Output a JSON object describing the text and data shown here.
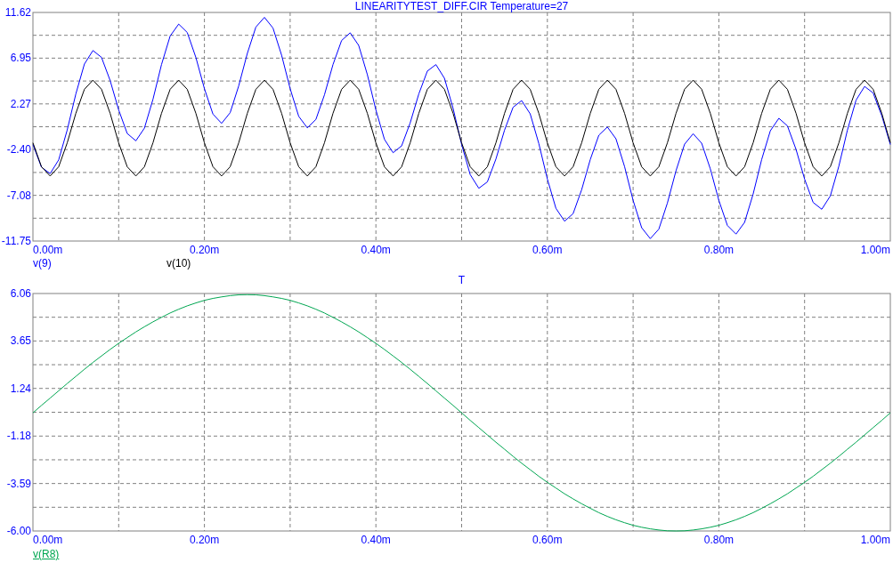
{
  "plots": [
    {
      "legend": [
        {
          "selected": false
        },
        {
          "selected": false
        }
      ],
      "chart_data": {
        "type": "line",
        "grid": true,
        "title": "LINEARITYTEST_DIFF.CIR Temperature=27",
        "x": [
          0,
          0.01,
          0.02,
          0.03,
          0.04,
          0.05,
          0.06,
          0.07,
          0.08,
          0.09,
          0.1,
          0.11,
          0.12,
          0.13,
          0.14,
          0.15,
          0.16,
          0.17,
          0.18,
          0.19,
          0.2,
          0.21,
          0.22,
          0.23,
          0.24,
          0.25,
          0.26,
          0.27,
          0.28,
          0.29,
          0.3,
          0.31,
          0.32,
          0.33,
          0.34,
          0.35,
          0.36,
          0.37,
          0.38,
          0.39,
          0.4,
          0.41,
          0.42,
          0.43,
          0.44,
          0.45,
          0.46,
          0.47,
          0.48,
          0.49,
          0.5,
          0.51,
          0.52,
          0.53,
          0.54,
          0.55,
          0.56,
          0.57,
          0.58,
          0.59,
          0.6,
          0.61,
          0.62,
          0.63,
          0.64,
          0.65,
          0.66,
          0.67,
          0.68,
          0.69,
          0.7,
          0.71,
          0.72,
          0.73,
          0.74,
          0.75,
          0.76,
          0.77,
          0.78,
          0.79,
          0.8,
          0.81,
          0.82,
          0.83,
          0.84,
          0.85,
          0.86,
          0.87,
          0.88,
          0.89,
          0.9,
          0.91,
          0.92,
          0.93,
          0.94,
          0.95,
          0.96,
          0.97,
          0.98,
          0.99,
          1
        ],
        "series": [
          {
            "name": "v(9)",
            "color": "#0000ff",
            "values": [
              -1.88,
              -4.2,
              -4.86,
              -3.46,
              -0.39,
              3.29,
              6.35,
              7.73,
              7.03,
              4.66,
              1.65,
              -0.76,
              -1.5,
              -0.21,
              2.74,
              6.29,
              9.21,
              10.43,
              9.57,
              7.02,
              3.83,
              1.23,
              0.28,
              1.37,
              4.11,
              7.44,
              10.13,
              11.12,
              10.03,
              7.25,
              3.83,
              1.0,
              -0.18,
              0.68,
              3.19,
              6.29,
              8.76,
              9.54,
              8.25,
              5.26,
              1.65,
              -1.36,
              -2.72,
              -2.02,
              0.33,
              3.29,
              5.63,
              6.29,
              4.89,
              1.82,
              -1.88,
              -4.96,
              -6.36,
              -5.7,
              -3.37,
              -0.41,
              1.93,
              2.61,
              1.25,
              -1.78,
              -5.41,
              -8.4,
              -9.72,
              -8.95,
              -6.5,
              -3.41,
              -0.93,
              -0.09,
              -1.29,
              -4.14,
              -7.59,
              -10.39,
              -11.5,
              -10.53,
              -7.87,
              -4.56,
              -1.85,
              -0.78,
              -1.75,
              -4.37,
              -7.59,
              -10.16,
              -11.04,
              -9.84,
              -6.95,
              -3.41,
              -0.48,
              0.8,
              0.03,
              -2.38,
              -5.41,
              -7.8,
              -8.5,
              -7.14,
              -4.09,
              -0.41,
              2.65,
              4.05,
              3.39,
              1.06,
              -1.88
            ]
          },
          {
            "name": "v(10)",
            "color": "#000000",
            "values": [
              -1.71,
              -4.16,
              -5.1,
              -4.16,
              -1.71,
              1.31,
              3.76,
              4.7,
              3.76,
              1.31,
              -1.71,
              -4.16,
              -5.1,
              -4.16,
              -1.71,
              1.31,
              3.76,
              4.7,
              3.76,
              1.31,
              -1.71,
              -4.16,
              -5.1,
              -4.16,
              -1.71,
              1.31,
              3.76,
              4.7,
              3.76,
              1.31,
              -1.71,
              -4.16,
              -5.1,
              -4.16,
              -1.71,
              1.31,
              3.76,
              4.7,
              3.76,
              1.31,
              -1.71,
              -4.16,
              -5.1,
              -4.16,
              -1.71,
              1.31,
              3.76,
              4.7,
              3.76,
              1.31,
              -1.71,
              -4.16,
              -5.1,
              -4.16,
              -1.71,
              1.31,
              3.76,
              4.7,
              3.76,
              1.31,
              -1.71,
              -4.16,
              -5.1,
              -4.16,
              -1.71,
              1.31,
              3.76,
              4.7,
              3.76,
              1.31,
              -1.71,
              -4.16,
              -5.1,
              -4.16,
              -1.71,
              1.31,
              3.76,
              4.7,
              3.76,
              1.31,
              -1.71,
              -4.16,
              -5.1,
              -4.16,
              -1.71,
              1.31,
              3.76,
              4.7,
              3.76,
              1.31,
              -1.71,
              -4.16,
              -5.1,
              -4.16,
              -1.71,
              1.31,
              3.76,
              4.7,
              3.76,
              1.31,
              -1.71
            ]
          }
        ],
        "xlim": [
          0,
          1
        ],
        "ylim": [
          -11.75,
          11.62
        ],
        "xticks": [
          {
            "value": 0,
            "label": "0.00m"
          },
          {
            "value": 0.2,
            "label": "0.20m"
          },
          {
            "value": 0.4,
            "label": "0.40m"
          },
          {
            "value": 0.6,
            "label": "0.60m"
          },
          {
            "value": 0.8,
            "label": "0.80m"
          },
          {
            "value": 1,
            "label": "1.00m"
          }
        ],
        "yticks": [
          {
            "value": -11.75,
            "label": "-11.75"
          },
          {
            "value": -7.08,
            "label": "-7.08"
          },
          {
            "value": -2.4,
            "label": "-2.40"
          },
          {
            "value": 2.27,
            "label": "2.27"
          },
          {
            "value": 6.95,
            "label": "6.95"
          },
          {
            "value": 11.62,
            "label": "11.62"
          }
        ]
      }
    },
    {
      "legend": [
        {
          "selected": true
        }
      ],
      "chart_data": {
        "type": "line",
        "grid": true,
        "title": "T",
        "x": [
          0,
          0.01,
          0.02,
          0.03,
          0.04,
          0.05,
          0.06,
          0.07,
          0.08,
          0.09,
          0.1,
          0.11,
          0.12,
          0.13,
          0.14,
          0.15,
          0.16,
          0.17,
          0.18,
          0.19,
          0.2,
          0.21,
          0.22,
          0.23,
          0.24,
          0.25,
          0.26,
          0.27,
          0.28,
          0.29,
          0.3,
          0.31,
          0.32,
          0.33,
          0.34,
          0.35,
          0.36,
          0.37,
          0.38,
          0.39,
          0.4,
          0.41,
          0.42,
          0.43,
          0.44,
          0.45,
          0.46,
          0.47,
          0.48,
          0.49,
          0.5,
          0.51,
          0.52,
          0.53,
          0.54,
          0.55,
          0.56,
          0.57,
          0.58,
          0.59,
          0.6,
          0.61,
          0.62,
          0.63,
          0.64,
          0.65,
          0.66,
          0.67,
          0.68,
          0.69,
          0.7,
          0.71,
          0.72,
          0.73,
          0.74,
          0.75,
          0.76,
          0.77,
          0.78,
          0.79,
          0.8,
          0.81,
          0.82,
          0.83,
          0.84,
          0.85,
          0.86,
          0.87,
          0.88,
          0.89,
          0.9,
          0.91,
          0.92,
          0.93,
          0.94,
          0.95,
          0.96,
          0.97,
          0.98,
          0.99,
          1
        ],
        "series": [
          {
            "name": "v(R8)",
            "color": "#00a651",
            "values": [
              0,
              0.38,
              0.75,
              1.12,
              1.49,
              1.85,
              2.21,
              2.56,
              2.89,
              3.22,
              3.53,
              3.82,
              4.11,
              4.37,
              4.62,
              4.85,
              5.07,
              5.26,
              5.43,
              5.58,
              5.71,
              5.81,
              5.89,
              5.95,
              5.99,
              6.0,
              5.99,
              5.95,
              5.89,
              5.81,
              5.71,
              5.58,
              5.43,
              5.26,
              5.07,
              4.85,
              4.62,
              4.37,
              4.11,
              3.82,
              3.53,
              3.22,
              2.89,
              2.56,
              2.21,
              1.85,
              1.49,
              1.12,
              0.75,
              0.38,
              0,
              -0.38,
              -0.75,
              -1.12,
              -1.49,
              -1.85,
              -2.21,
              -2.56,
              -2.89,
              -3.22,
              -3.53,
              -3.82,
              -4.11,
              -4.37,
              -4.62,
              -4.85,
              -5.07,
              -5.26,
              -5.43,
              -5.58,
              -5.71,
              -5.81,
              -5.89,
              -5.95,
              -5.99,
              -6.0,
              -5.99,
              -5.95,
              -5.89,
              -5.81,
              -5.71,
              -5.58,
              -5.43,
              -5.26,
              -5.07,
              -4.85,
              -4.62,
              -4.37,
              -4.11,
              -3.82,
              -3.53,
              -3.22,
              -2.89,
              -2.56,
              -2.21,
              -1.85,
              -1.49,
              -1.12,
              -0.75,
              -0.38,
              0
            ]
          }
        ],
        "xlim": [
          0,
          1
        ],
        "ylim": [
          -6.0,
          6.06
        ],
        "xticks": [
          {
            "value": 0,
            "label": "0.00m"
          },
          {
            "value": 0.2,
            "label": "0.20m"
          },
          {
            "value": 0.4,
            "label": "0.40m"
          },
          {
            "value": 0.6,
            "label": "0.60m"
          },
          {
            "value": 0.8,
            "label": "0.80m"
          },
          {
            "value": 1,
            "label": "1.00m"
          }
        ],
        "yticks": [
          {
            "value": -6.0,
            "label": "-6.00"
          },
          {
            "value": -3.59,
            "label": "-3.59"
          },
          {
            "value": -1.18,
            "label": "-1.18"
          },
          {
            "value": 1.24,
            "label": "1.24"
          },
          {
            "value": 3.65,
            "label": "3.65"
          },
          {
            "value": 6.06,
            "label": "6.06"
          }
        ]
      }
    }
  ]
}
